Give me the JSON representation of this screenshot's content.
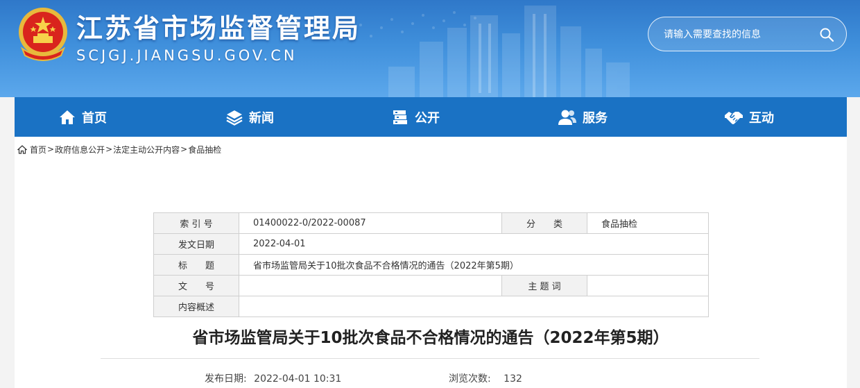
{
  "header": {
    "site_title": "江苏省市场监督管理局",
    "site_url": "SCJGJ.JIANGSU.GOV.CN",
    "emblem_icon": "national-emblem-icon",
    "search": {
      "placeholder": "请输入需要查找的信息",
      "value": "",
      "icon": "search-icon"
    }
  },
  "nav": {
    "items": [
      {
        "label": "首页",
        "icon": "home-icon"
      },
      {
        "label": "新闻",
        "icon": "layers-icon"
      },
      {
        "label": "公开",
        "icon": "books-icon"
      },
      {
        "label": "服务",
        "icon": "users-icon"
      },
      {
        "label": "互动",
        "icon": "handshake-icon"
      }
    ]
  },
  "breadcrumb": {
    "icon": "home-icon",
    "items": [
      "首页",
      "政府信息公开",
      "法定主动公开内容",
      "食品抽检"
    ],
    "separator": ">"
  },
  "doc_meta": {
    "index_label": "索 引 号",
    "index_value": "01400022-0/2022-00087",
    "category_label": "分　　类",
    "category_value": "食品抽检",
    "date_label": "发文日期",
    "date_value": "2022-04-01",
    "title_label": "标　　题",
    "title_value": "省市场监管局关于10批次食品不合格情况的通告（2022年第5期）",
    "docno_label": "文　　号",
    "docno_value": "",
    "keywords_label": "主 题 词",
    "keywords_value": "",
    "summary_label": "内容概述",
    "summary_value": ""
  },
  "article": {
    "title": "省市场监管局关于10批次食品不合格情况的通告（2022年第5期）",
    "publish_label": "发布日期:",
    "publish_value": "2022-04-01 10:31",
    "views_label": "浏览次数:",
    "views_value": "132"
  },
  "colors": {
    "banner_top": "#2f78c9",
    "nav_bg": "#1a72c4",
    "table_label_bg": "#f2f2f2",
    "border": "#cfcfcf"
  }
}
